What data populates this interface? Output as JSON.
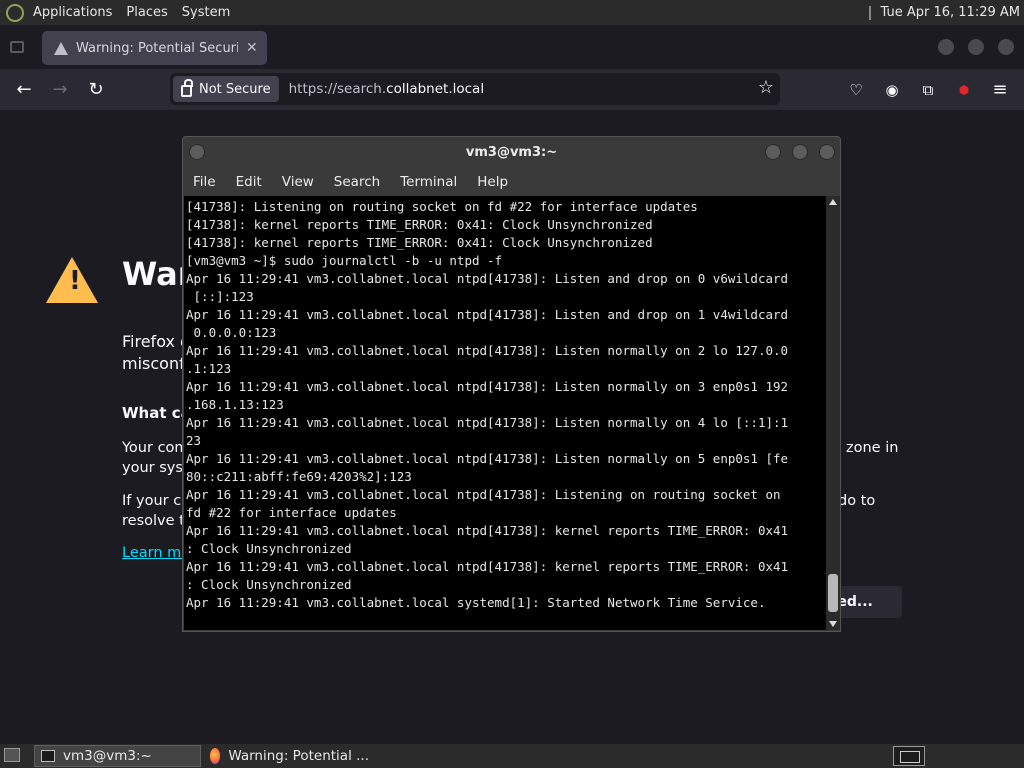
{
  "top_panel": {
    "menus": [
      "Applications",
      "Places",
      "System"
    ],
    "clock": "Tue Apr 16, 11:29 AM"
  },
  "browser": {
    "tab_title": "Warning: Potential Security",
    "security_label": "Not Secure",
    "url_prefix": "https://search.",
    "url_domain": "collabnet.local"
  },
  "page": {
    "title": "War",
    "para1_line1": "Firefox d",
    "para1_line2": "misconf",
    "heading": "What car",
    "para2_line1": "Your com",
    "para2_line1_end": "zone in",
    "para2_line2": "your syst",
    "para3_line1": "If your clo",
    "para3_line1_end": "do to",
    "para3_line2": "resolve th",
    "link": "Learn mo",
    "advanced_button": "ced..."
  },
  "terminal": {
    "title": "vm3@vm3:~",
    "menu": [
      "File",
      "Edit",
      "View",
      "Search",
      "Terminal",
      "Help"
    ],
    "lines": [
      "[41738]: Listening on routing socket on fd #22 for interface updates",
      "[41738]: kernel reports TIME_ERROR: 0x41: Clock Unsynchronized",
      "[41738]: kernel reports TIME_ERROR: 0x41: Clock Unsynchronized",
      "[vm3@vm3 ~]$ sudo journalctl -b -u ntpd -f",
      "Apr 16 11:29:41 vm3.collabnet.local ntpd[41738]: Listen and drop on 0 v6wildcard",
      " [::]:123",
      "Apr 16 11:29:41 vm3.collabnet.local ntpd[41738]: Listen and drop on 1 v4wildcard",
      " 0.0.0.0:123",
      "Apr 16 11:29:41 vm3.collabnet.local ntpd[41738]: Listen normally on 2 lo 127.0.0",
      ".1:123",
      "Apr 16 11:29:41 vm3.collabnet.local ntpd[41738]: Listen normally on 3 enp0s1 192",
      ".168.1.13:123",
      "Apr 16 11:29:41 vm3.collabnet.local ntpd[41738]: Listen normally on 4 lo [::1]:1",
      "23",
      "Apr 16 11:29:41 vm3.collabnet.local ntpd[41738]: Listen normally on 5 enp0s1 [fe",
      "80::c211:abff:fe69:4203%2]:123",
      "Apr 16 11:29:41 vm3.collabnet.local ntpd[41738]: Listening on routing socket on",
      "fd #22 for interface updates",
      "Apr 16 11:29:41 vm3.collabnet.local ntpd[41738]: kernel reports TIME_ERROR: 0x41",
      ": Clock Unsynchronized",
      "Apr 16 11:29:41 vm3.collabnet.local ntpd[41738]: kernel reports TIME_ERROR: 0x41",
      ": Clock Unsynchronized",
      "Apr 16 11:29:41 vm3.collabnet.local systemd[1]: Started Network Time Service."
    ]
  },
  "taskbar": {
    "items": [
      "vm3@vm3:~",
      "Warning: Potential ..."
    ]
  }
}
